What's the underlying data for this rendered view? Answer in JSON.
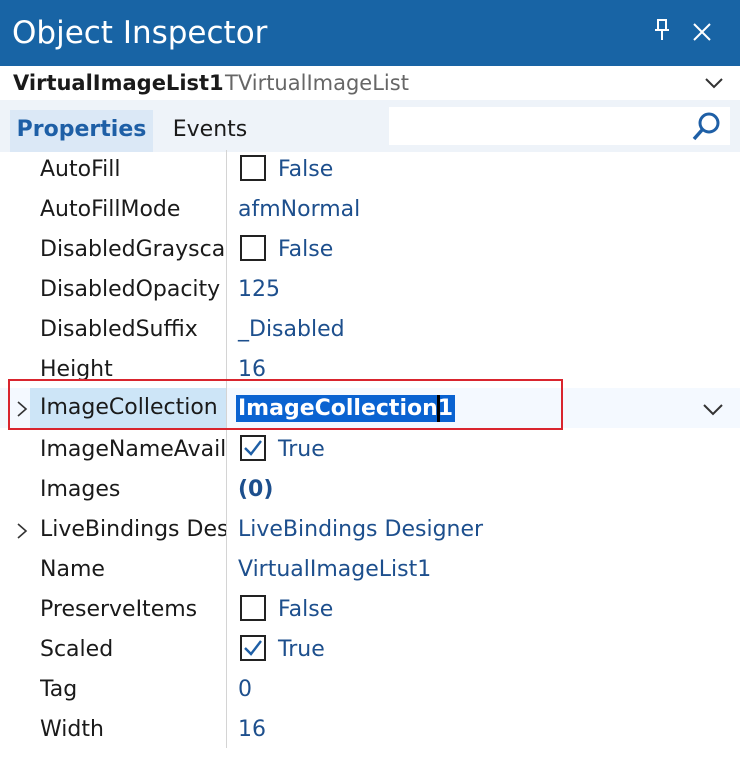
{
  "window": {
    "title": "Object Inspector",
    "pin_icon": "pin-icon",
    "close_icon": "close-icon"
  },
  "object_selector": {
    "name": "VirtualImageList1",
    "class_name": "TVirtualImageList"
  },
  "tabs": [
    {
      "label": "Properties",
      "active": true
    },
    {
      "label": "Events",
      "active": false
    }
  ],
  "search": {
    "placeholder": "",
    "value": ""
  },
  "colors": {
    "titlebar": "#1864a5",
    "value_text": "#1d4f8d",
    "selection_fill": "#0a63d1",
    "highlight_border": "#d9252e"
  },
  "properties": [
    {
      "name": "AutoFill",
      "value": "False",
      "checkbox": false
    },
    {
      "name": "AutoFillMode",
      "value": "afmNormal"
    },
    {
      "name": "DisabledGrayscale",
      "value": "False",
      "checkbox": false
    },
    {
      "name": "DisabledOpacity",
      "value": "125"
    },
    {
      "name": "DisabledSuffix",
      "value": "_Disabled"
    },
    {
      "name": "Height",
      "value": "16"
    },
    {
      "name": "ImageCollection",
      "value": "ImageCollection1",
      "expandable": true,
      "selected": true,
      "editing": true
    },
    {
      "name": "ImageNameAvailable",
      "value": "True",
      "checkbox": true
    },
    {
      "name": "Images",
      "value": "(0)",
      "bold": true
    },
    {
      "name": "LiveBindings Designer",
      "value": "LiveBindings Designer",
      "expandable": true
    },
    {
      "name": "Name",
      "value": "VirtualImageList1"
    },
    {
      "name": "PreserveItems",
      "value": "False",
      "checkbox": false
    },
    {
      "name": "Scaled",
      "value": "True",
      "checkbox": true
    },
    {
      "name": "Tag",
      "value": "0"
    },
    {
      "name": "Width",
      "value": "16"
    }
  ]
}
